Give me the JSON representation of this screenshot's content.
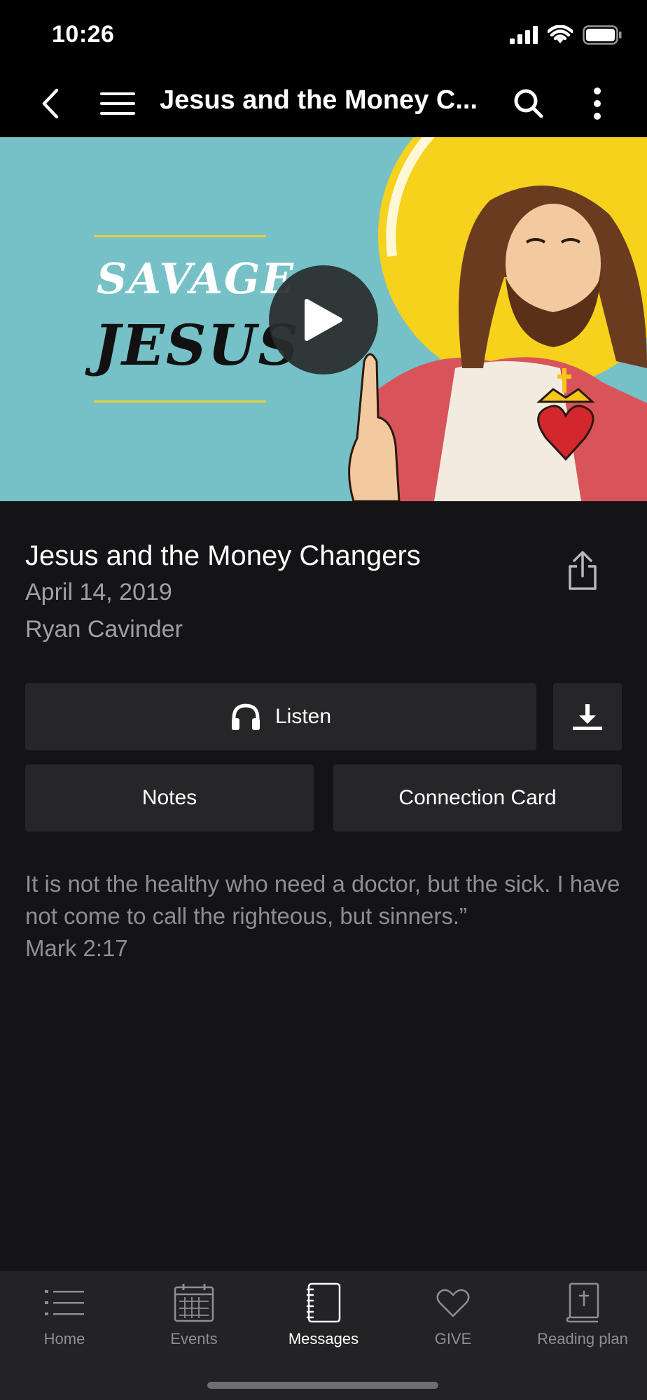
{
  "status": {
    "time": "10:26"
  },
  "header": {
    "title": "Jesus and the Money C..."
  },
  "hero": {
    "line1": "SAVAGE",
    "line2": "JESUS"
  },
  "sermon": {
    "title": "Jesus and the Money Changers",
    "date": "April 14, 2019",
    "speaker": "Ryan Cavinder"
  },
  "actions": {
    "listen": "Listen",
    "notes": "Notes",
    "connection_card": "Connection Card"
  },
  "description": {
    "text": "It is not the healthy who need a doctor, but the sick. I have not come to call the righteous, but sinners.”",
    "reference": "Mark 2:17"
  },
  "tabs": [
    {
      "label": "Home",
      "icon": "list-icon"
    },
    {
      "label": "Events",
      "icon": "calendar-icon"
    },
    {
      "label": "Messages",
      "icon": "notebook-icon"
    },
    {
      "label": "GIVE",
      "icon": "heart-icon"
    },
    {
      "label": "Reading plan",
      "icon": "bible-icon"
    }
  ],
  "colors": {
    "background": "#141416",
    "hero_teal": "#76c0c7",
    "hero_yellow": "#f6d21c",
    "button": "#262628",
    "muted_text": "#a0a0a4"
  }
}
